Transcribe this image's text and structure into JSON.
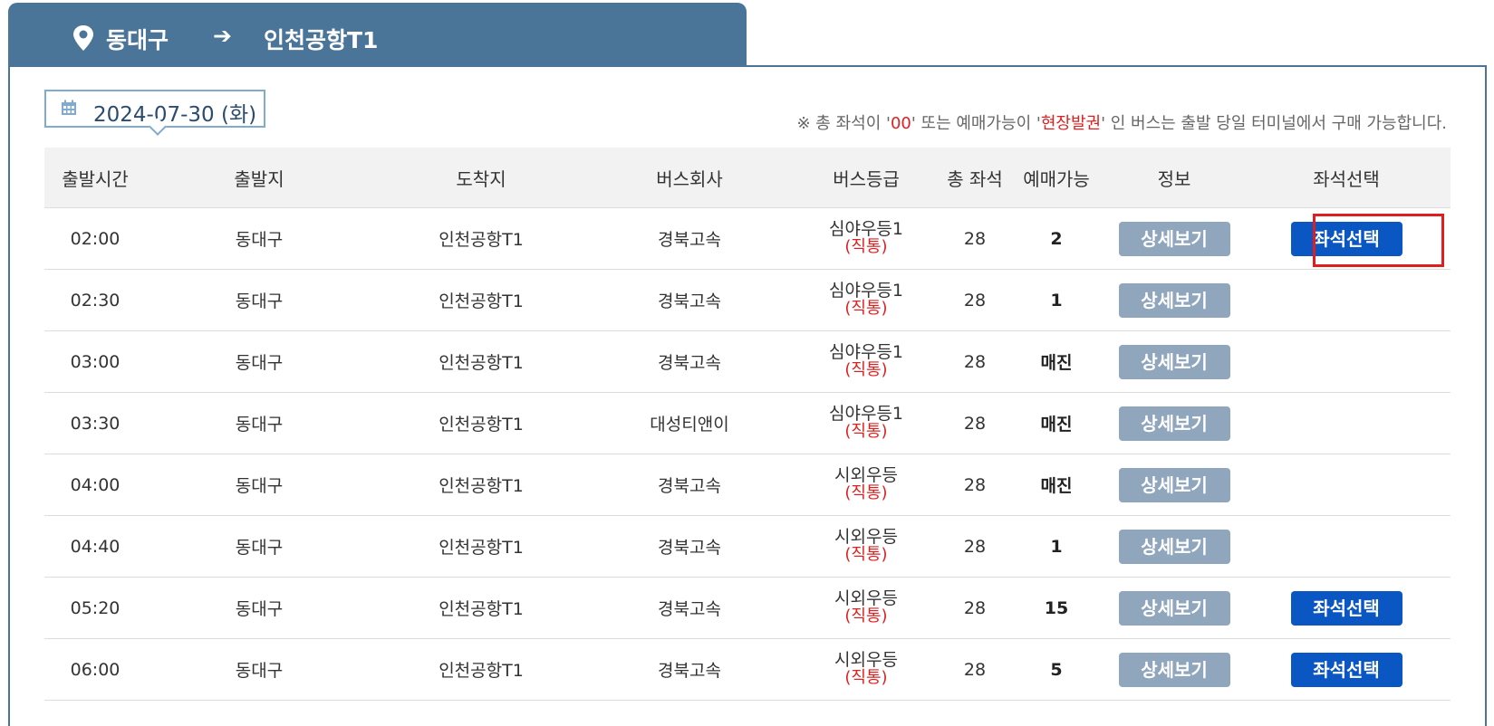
{
  "route": {
    "from": "동대구",
    "arrow": "➔",
    "to": "인천공항T1"
  },
  "date": "2024-07-30 (화)",
  "notice": {
    "part1": "※ 총 좌석이 '",
    "highlight1": "00",
    "part2": "' 또는 예매가능이 '",
    "highlight2": "현장발권",
    "part3": "' 인 버스는 출발 당일 터미널에서 구매 가능합니다."
  },
  "colors": {
    "header_tab": "#4a7599",
    "detail_button": "#8fa6bd",
    "seat_button": "#0a56c2",
    "direct_text": "#e02020"
  },
  "table": {
    "headers": [
      "출발시간",
      "출발지",
      "도착지",
      "버스회사",
      "버스등급",
      "총 좌석",
      "예매가능",
      "정보",
      "좌석선택"
    ],
    "detail_label": "상세보기",
    "seat_label": "좌석선택",
    "rows": [
      {
        "time": "02:00",
        "origin": "동대구",
        "dest": "인천공항T1",
        "company": "경북고속",
        "grade": "심야우등1",
        "grade_sub": "(직통)",
        "seats": "28",
        "avail": "2",
        "seat_button": true
      },
      {
        "time": "02:30",
        "origin": "동대구",
        "dest": "인천공항T1",
        "company": "경북고속",
        "grade": "심야우등1",
        "grade_sub": "(직통)",
        "seats": "28",
        "avail": "1",
        "seat_button": false
      },
      {
        "time": "03:00",
        "origin": "동대구",
        "dest": "인천공항T1",
        "company": "경북고속",
        "grade": "심야우등1",
        "grade_sub": "(직통)",
        "seats": "28",
        "avail": "매진",
        "seat_button": false
      },
      {
        "time": "03:30",
        "origin": "동대구",
        "dest": "인천공항T1",
        "company": "대성티앤이",
        "grade": "심야우등1",
        "grade_sub": "(직통)",
        "seats": "28",
        "avail": "매진",
        "seat_button": false
      },
      {
        "time": "04:00",
        "origin": "동대구",
        "dest": "인천공항T1",
        "company": "경북고속",
        "grade": "시외우등",
        "grade_sub": "(직통)",
        "seats": "28",
        "avail": "매진",
        "seat_button": false
      },
      {
        "time": "04:40",
        "origin": "동대구",
        "dest": "인천공항T1",
        "company": "경북고속",
        "grade": "시외우등",
        "grade_sub": "(직통)",
        "seats": "28",
        "avail": "1",
        "seat_button": false
      },
      {
        "time": "05:20",
        "origin": "동대구",
        "dest": "인천공항T1",
        "company": "경북고속",
        "grade": "시외우등",
        "grade_sub": "(직통)",
        "seats": "28",
        "avail": "15",
        "seat_button": true
      },
      {
        "time": "06:00",
        "origin": "동대구",
        "dest": "인천공항T1",
        "company": "경북고속",
        "grade": "시외우등",
        "grade_sub": "(직통)",
        "seats": "28",
        "avail": "5",
        "seat_button": true
      }
    ]
  }
}
